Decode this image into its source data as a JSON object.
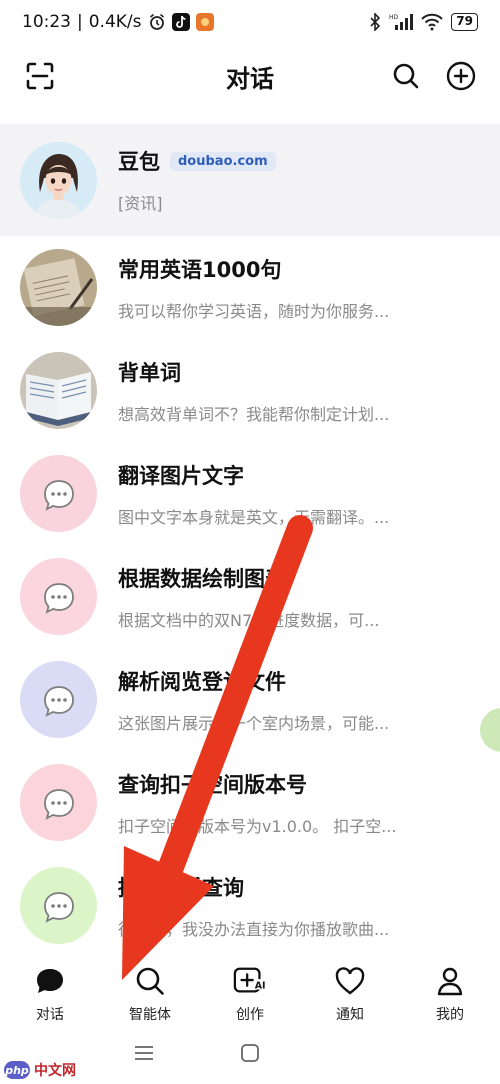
{
  "status_bar": {
    "time": "10:23",
    "network_speed": "0.4K/s",
    "hd_label": "HD",
    "battery": "79"
  },
  "header": {
    "title": "对话"
  },
  "chats": [
    {
      "title": "豆包",
      "badge": "doubao.com",
      "preview": "[资讯]",
      "avatar": "girl-avatar",
      "pinned": true
    },
    {
      "title": "常用英语1000句",
      "preview": "我可以帮你学习英语，随时为你服务...",
      "avatar": "notebook-photo",
      "avatar_color": "#b8a98c"
    },
    {
      "title": "背单词",
      "preview": "想高效背单词不？我能帮你制定计划...",
      "avatar": "book-photo",
      "avatar_color": "#a9b7c6"
    },
    {
      "title": "翻译图片文字",
      "preview": "图中文字本身就是英文，无需翻译。...",
      "avatar": "chat-bubble",
      "avatar_color": "#f9d4de"
    },
    {
      "title": "根据数据绘制图表",
      "preview": "根据文档中的双N7级进度数据，可...",
      "avatar": "chat-bubble",
      "avatar_color": "#fbd6df"
    },
    {
      "title": "解析阅览登记文件",
      "preview": "这张图片展示了一个室内场景，可能...",
      "avatar": "chat-bubble",
      "avatar_color": "#dadcf6"
    },
    {
      "title": "查询扣子空间版本号",
      "preview": "扣子空间的版本号为v1.0.0。 扣子空...",
      "avatar": "chat-bubble",
      "avatar_color": "#fbd4dc"
    },
    {
      "title": "播放音乐查询",
      "preview": "很抱歉，我没办法直接为你播放歌曲...",
      "avatar": "chat-bubble",
      "avatar_color": "#dbf5c8"
    }
  ],
  "bottom_nav": [
    {
      "label": "对话",
      "icon": "chat-icon",
      "active": true
    },
    {
      "label": "智能体",
      "icon": "search-icon"
    },
    {
      "label": "创作",
      "icon": "create-ai-icon"
    },
    {
      "label": "通知",
      "icon": "heart-icon"
    },
    {
      "label": "我的",
      "icon": "profile-icon"
    }
  ],
  "watermark": {
    "logo": "php",
    "text": "中文网"
  },
  "colors": {
    "arrow": "#e8371f",
    "badge_text": "#2f5db8",
    "pinned_bg": "#f3f3f5"
  }
}
